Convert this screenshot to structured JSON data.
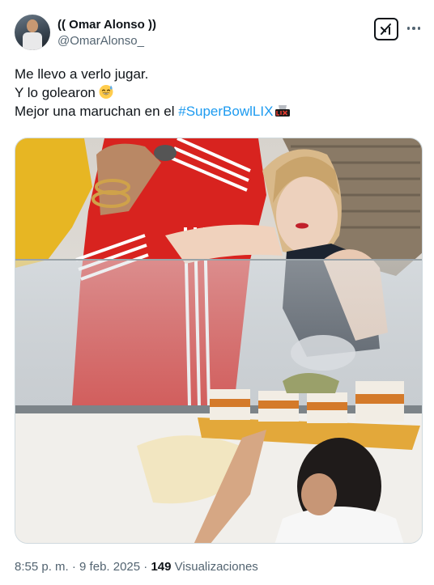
{
  "author": {
    "display_name": "(( Omar Alonso ))",
    "handle": "@OmarAlonso_"
  },
  "actions": {
    "grok_icon": "grok-icon",
    "more_icon": "more-options-icon"
  },
  "tweet": {
    "line1": "Me llevo a verlo jugar.",
    "line2": "Y lo golearon",
    "line2_emoji": "sweat-smile-emoji",
    "line3_prefix": "Mejor una maruchan en el ",
    "line3_hashtag": "#SuperBowlLIX",
    "line3_hashflag": "super-bowl-lix-logo"
  },
  "footer": {
    "time": "8:55 p. m.",
    "separator": "·",
    "date": "9 feb. 2025",
    "views_count": "149",
    "views_label": "Visualizaciones"
  },
  "colors": {
    "link": "#1d9bf0",
    "secondary_text": "#536471",
    "primary_text": "#0f1419",
    "border": "#cfd9de"
  }
}
